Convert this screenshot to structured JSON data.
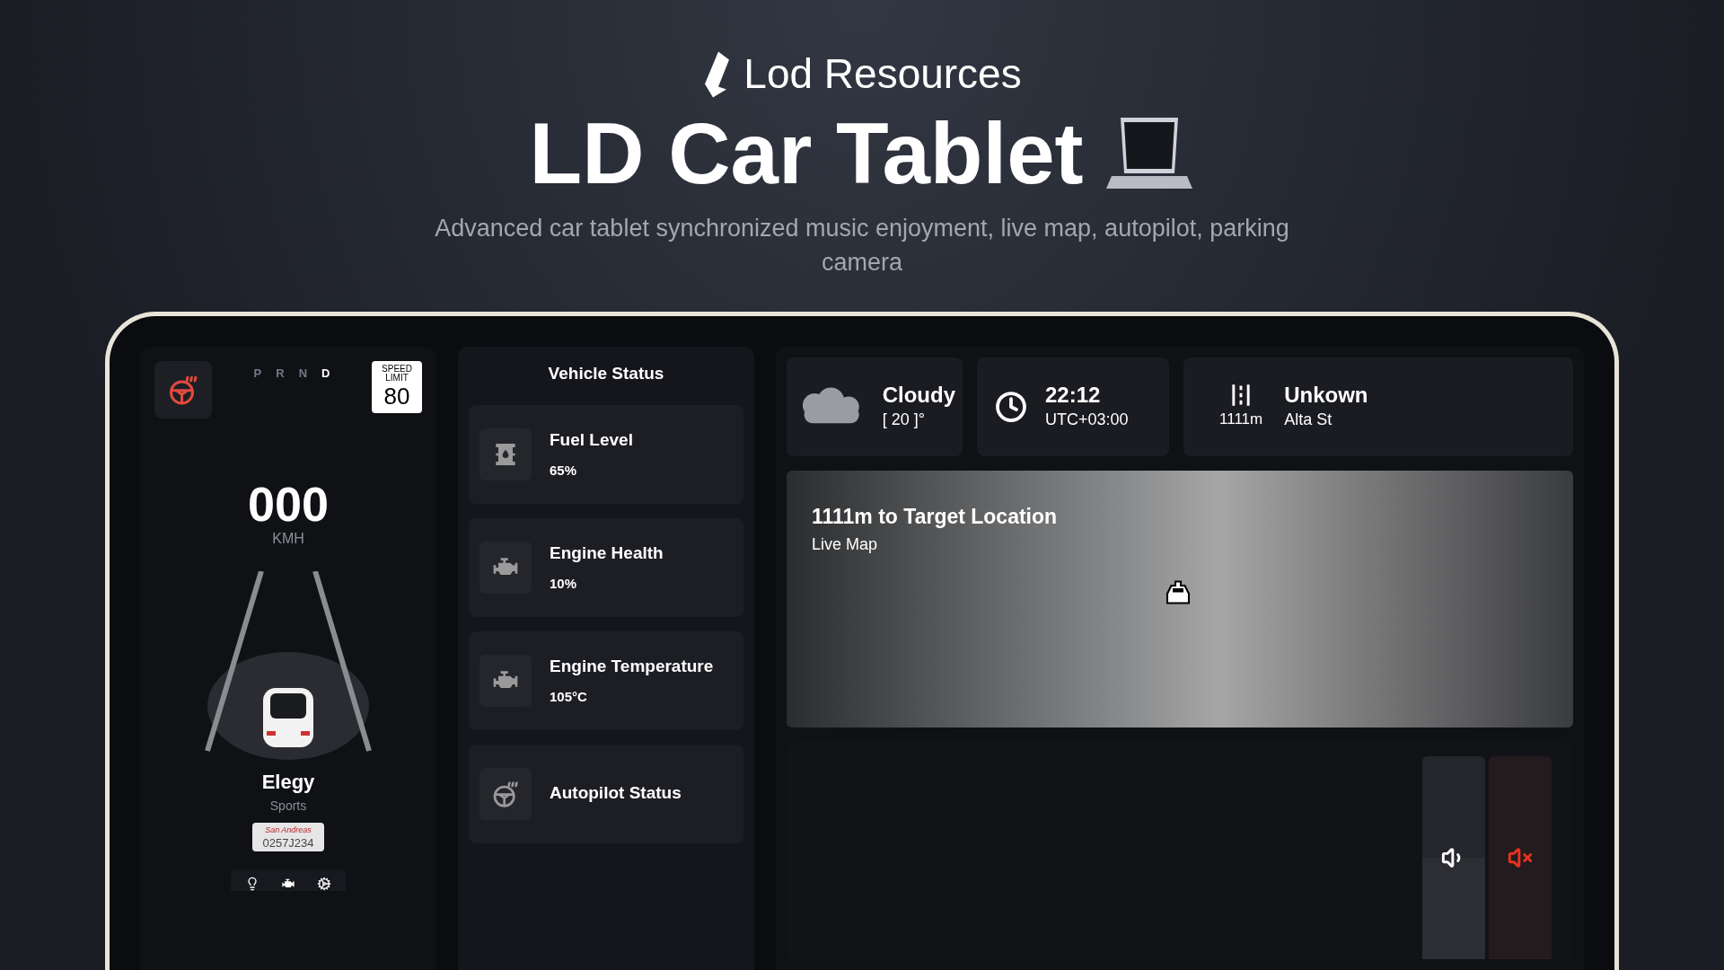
{
  "brand": {
    "name": "Lod Resources"
  },
  "hero": {
    "title": "LD Car Tablet",
    "subtitle": "Advanced car tablet synchronized music enjoyment, live map, autopilot, parking camera"
  },
  "drive_panel": {
    "gears": [
      {
        "label": "P",
        "selected": false
      },
      {
        "label": "R",
        "selected": false
      },
      {
        "label": "N",
        "selected": false
      },
      {
        "label": "D",
        "selected": true
      }
    ],
    "speed_limit": {
      "label": "SPEED LIMIT",
      "value": "80"
    },
    "speed": "000",
    "unit": "KMH",
    "car_name": "Elegy",
    "car_class": "Sports",
    "plate": {
      "state": "San Andreas",
      "number": "0257J234"
    }
  },
  "vehicle_status": {
    "title": "Vehicle Status",
    "items": [
      {
        "kind": "fuel",
        "label": "Fuel Level",
        "value": "65%"
      },
      {
        "kind": "engine",
        "label": "Engine Health",
        "value": "10%"
      },
      {
        "kind": "engine",
        "label": "Engine Temperature",
        "value": "105°C"
      },
      {
        "kind": "autopilot",
        "label": "Autopilot Status"
      }
    ]
  },
  "weather": {
    "condition": "Cloudy",
    "temperature": "[ 20 ]°"
  },
  "clock": {
    "time": "22:12",
    "zone": "UTC+03:00"
  },
  "route": {
    "distance": "1111m",
    "street_title": "Unkown",
    "street": "Alta St"
  },
  "map": {
    "title": "1111m to Target Location",
    "subtitle": "Live Map"
  },
  "audio": {
    "level": 0.5,
    "muted": true
  }
}
